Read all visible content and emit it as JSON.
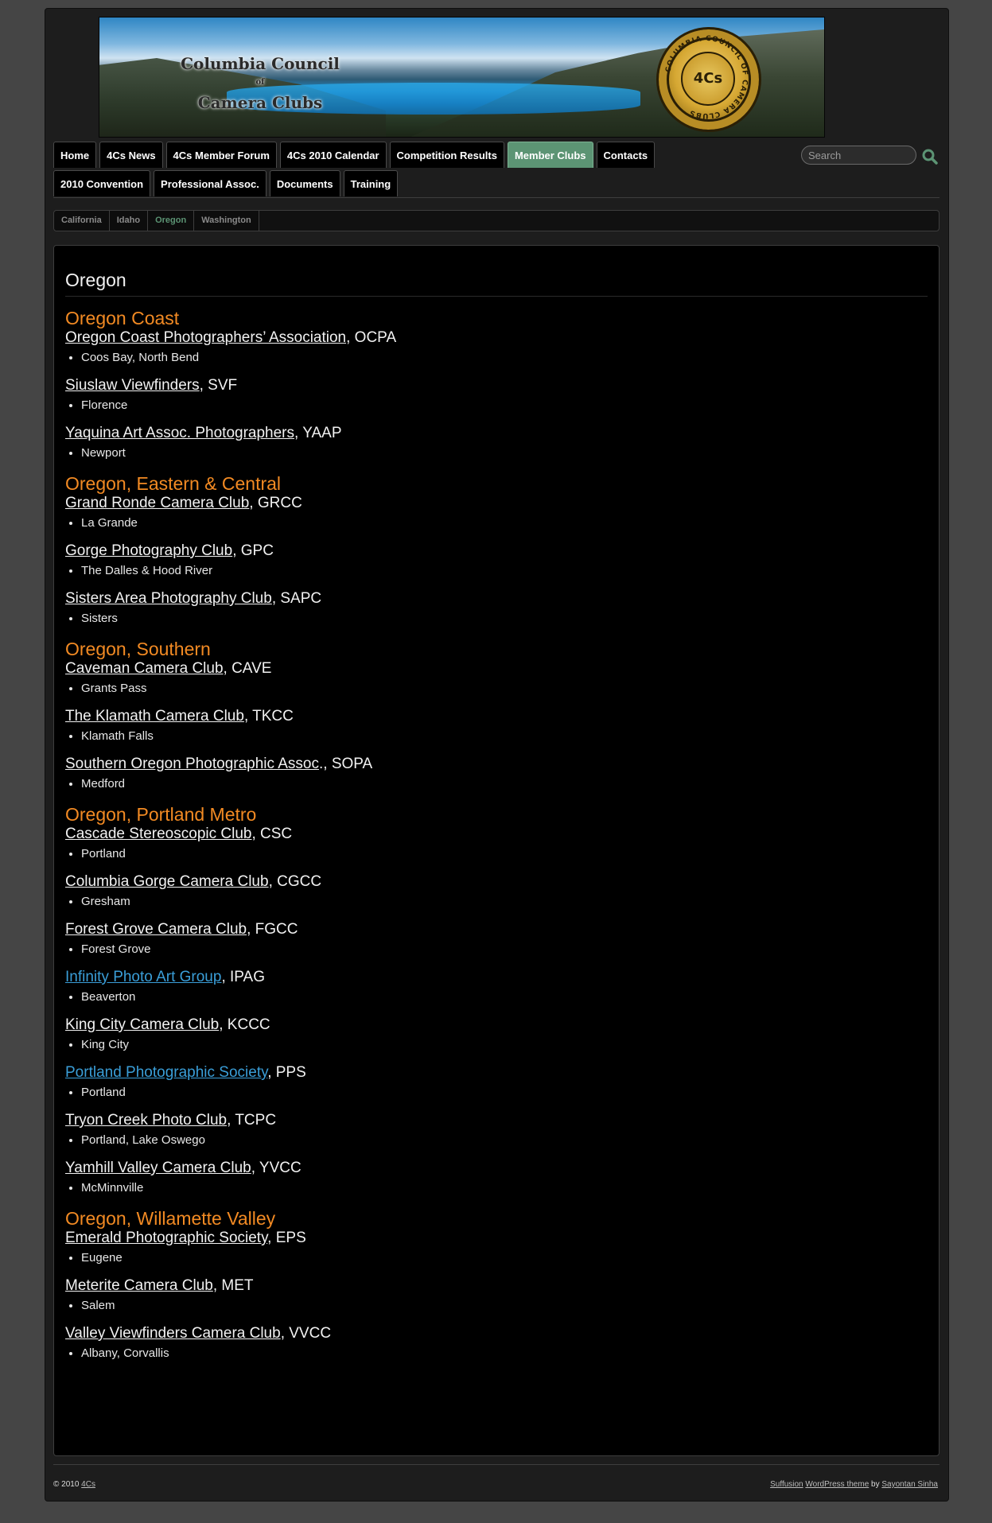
{
  "header": {
    "title_line1": "Columbia Council",
    "title_line2": "of",
    "title_line3": "Camera Clubs",
    "seal_text": "4Cs",
    "seal_ring_text": "COLUMBIA COUNCIL OF CAMERA CLUBS"
  },
  "nav": {
    "row1": [
      "Home",
      "4Cs News",
      "4Cs Member Forum",
      "4Cs 2010 Calendar",
      "Competition Results",
      "Member Clubs",
      "Contacts"
    ],
    "row2": [
      "2010 Convention",
      "Professional Assoc.",
      "Documents",
      "Training"
    ],
    "active": "Member Clubs"
  },
  "search": {
    "placeholder": "Search"
  },
  "subnav": {
    "items": [
      "California",
      "Idaho",
      "Oregon",
      "Washington"
    ],
    "active": "Oregon"
  },
  "page": {
    "title": "Oregon",
    "regions": [
      {
        "name": "Oregon Coast",
        "clubs": [
          {
            "name": "Oregon Coast Photographers’ Association",
            "abbr": ", OCPA",
            "location": "Coos Bay, North Bend",
            "link_color": "white"
          },
          {
            "name": "Siuslaw Viewfinders",
            "abbr": ", SVF",
            "location": "Florence",
            "link_color": "white"
          },
          {
            "name": "Yaquina Art Assoc. Photographers",
            "abbr": ", YAAP",
            "location": "Newport",
            "link_color": "white"
          }
        ]
      },
      {
        "name": "Oregon, Eastern & Central",
        "clubs": [
          {
            "name": "Grand Ronde Camera Club",
            "abbr": ", GRCC",
            "location": "La Grande",
            "link_color": "white"
          },
          {
            "name": "Gorge Photography Club",
            "abbr": ", GPC",
            "location": "The Dalles & Hood River",
            "link_color": "white"
          },
          {
            "name": "Sisters Area Photography Club",
            "abbr": ", SAPC",
            "location": "Sisters",
            "link_color": "white"
          }
        ]
      },
      {
        "name": "Oregon, Southern",
        "clubs": [
          {
            "name": "Caveman Camera Club",
            "abbr": ", CAVE",
            "location": "Grants Pass",
            "link_color": "white"
          },
          {
            "name": "The Klamath Camera Club",
            "abbr": ", TKCC",
            "location": "Klamath Falls",
            "link_color": "white"
          },
          {
            "name": "Southern Oregon Photographic Assoc",
            "abbr": "., SOPA",
            "location": "Medford",
            "link_color": "white"
          }
        ]
      },
      {
        "name": "Oregon, Portland Metro",
        "clubs": [
          {
            "name": "Cascade Stereoscopic Club",
            "abbr": ", CSC",
            "location": "Portland",
            "link_color": "white"
          },
          {
            "name": "Columbia Gorge Camera Club",
            "abbr": ", CGCC",
            "location": "Gresham",
            "link_color": "white"
          },
          {
            "name": "Forest Grove Camera Club",
            "abbr": ", FGCC",
            "location": "Forest Grove",
            "link_color": "white"
          },
          {
            "name": "Infinity Photo Art Group",
            "abbr": ", IPAG",
            "location": "Beaverton",
            "link_color": "blue"
          },
          {
            "name": "King City Camera Club",
            "abbr": ", KCCC",
            "location": "King City",
            "link_color": "white"
          },
          {
            "name": "Portland Photographic Society",
            "abbr": ", PPS",
            "location": "Portland",
            "link_color": "blue"
          },
          {
            "name": "Tryon Creek Photo Club",
            "abbr": ", TCPC",
            "location": "Portland, Lake Oswego",
            "link_color": "white"
          },
          {
            "name": "Yamhill Valley Camera Club",
            "abbr": ", YVCC",
            "location": "McMinnville",
            "link_color": "white"
          }
        ]
      },
      {
        "name": "Oregon, Willamette Valley",
        "clubs": [
          {
            "name": "Emerald Photographic Society",
            "abbr": ", EPS",
            "location": "Eugene",
            "link_color": "white"
          },
          {
            "name": "Meterite Camera Club",
            "abbr": ", MET",
            "location": "Salem",
            "link_color": "white"
          },
          {
            "name": "Valley Viewfinders Camera Club",
            "abbr": ", VVCC",
            "location": "Albany, Corvallis",
            "link_color": "white"
          }
        ]
      }
    ]
  },
  "footer": {
    "copyright": "© 2010 ",
    "site_link": "4Cs",
    "theme_link": "Suffusion",
    "wp_link": "WordPress theme",
    "by_text": " by ",
    "author_link": "Sayontan Sinha"
  },
  "colors": {
    "accent_green": "#5c9474",
    "region_orange": "#f28a23",
    "link_blue": "#3a9ed8",
    "background": "#454545"
  }
}
